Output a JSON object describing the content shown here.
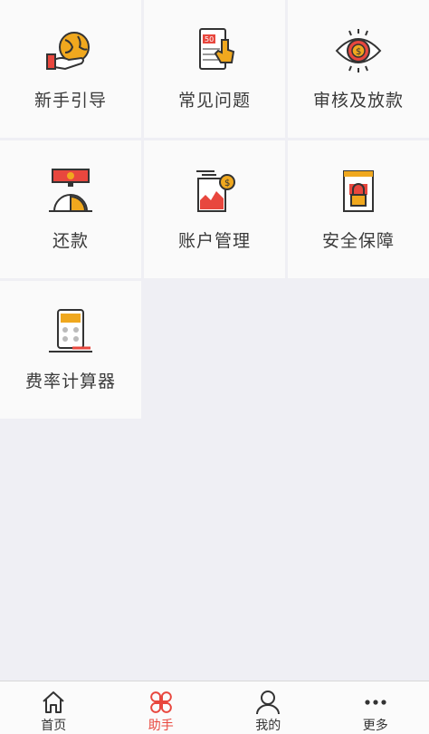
{
  "grid": {
    "items": [
      {
        "label": "新手引导",
        "icon": "hand-globe-icon"
      },
      {
        "label": "常见问题",
        "icon": "phone-touch-icon"
      },
      {
        "label": "审核及放款",
        "icon": "eye-dollar-icon"
      },
      {
        "label": "还款",
        "icon": "stopwatch-money-icon"
      },
      {
        "label": "账户管理",
        "icon": "account-chart-icon"
      },
      {
        "label": "安全保障",
        "icon": "security-lock-icon"
      },
      {
        "label": "费率计算器",
        "icon": "calculator-icon"
      }
    ]
  },
  "tabbar": {
    "items": [
      {
        "label": "首页",
        "icon": "home-icon",
        "active": false
      },
      {
        "label": "助手",
        "icon": "clover-icon",
        "active": true
      },
      {
        "label": "我的",
        "icon": "user-icon",
        "active": false
      },
      {
        "label": "更多",
        "icon": "more-icon",
        "active": false
      }
    ]
  },
  "colors": {
    "accent": "#e8473e",
    "orange": "#f0a81e",
    "background": "#efeff4"
  }
}
